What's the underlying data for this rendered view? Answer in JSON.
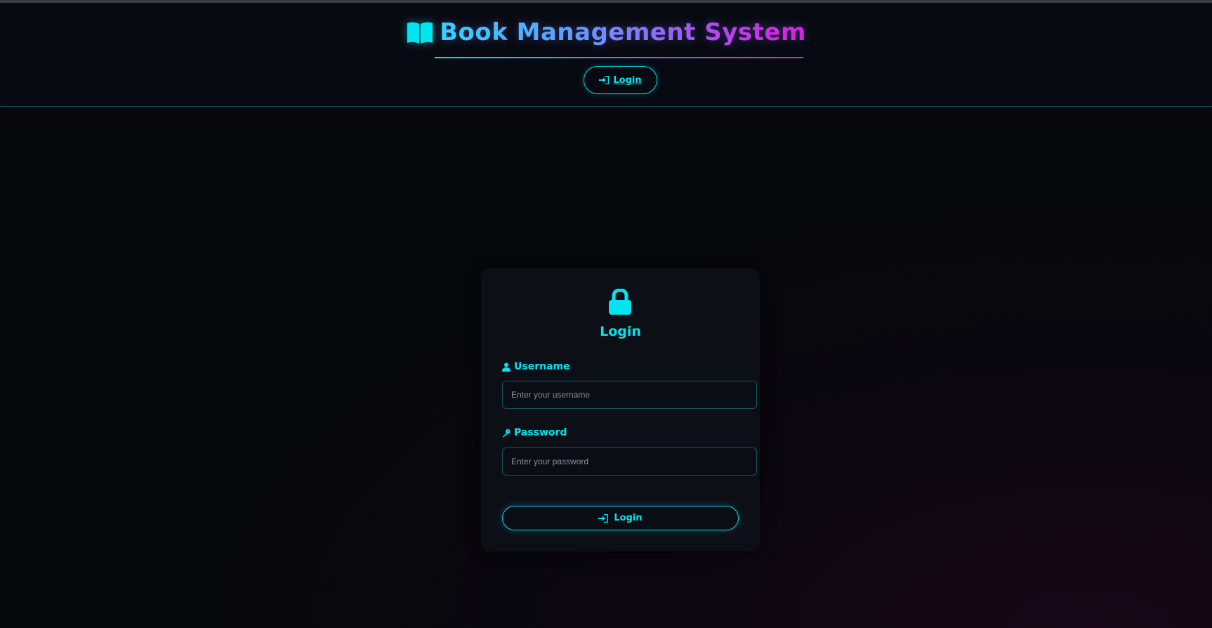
{
  "header": {
    "title": "Book Management System",
    "nav_login_label": "Login"
  },
  "login_card": {
    "title": "Login",
    "username": {
      "label": "Username",
      "placeholder": "Enter your username",
      "value": ""
    },
    "password": {
      "label": "Password",
      "placeholder": "Enter your password",
      "value": ""
    },
    "submit_label": "Login"
  },
  "icons": {
    "title": "book-open-icon",
    "nav_login": "sign-in-icon",
    "card": "lock-icon",
    "username": "user-icon",
    "password": "key-icon",
    "submit": "sign-in-icon"
  },
  "colors": {
    "accent": "#00e5f0",
    "gradient_start": "#2ed3ff",
    "gradient_end": "#e01ce0",
    "background": "#07080c",
    "card_background": "#0d0f17"
  }
}
